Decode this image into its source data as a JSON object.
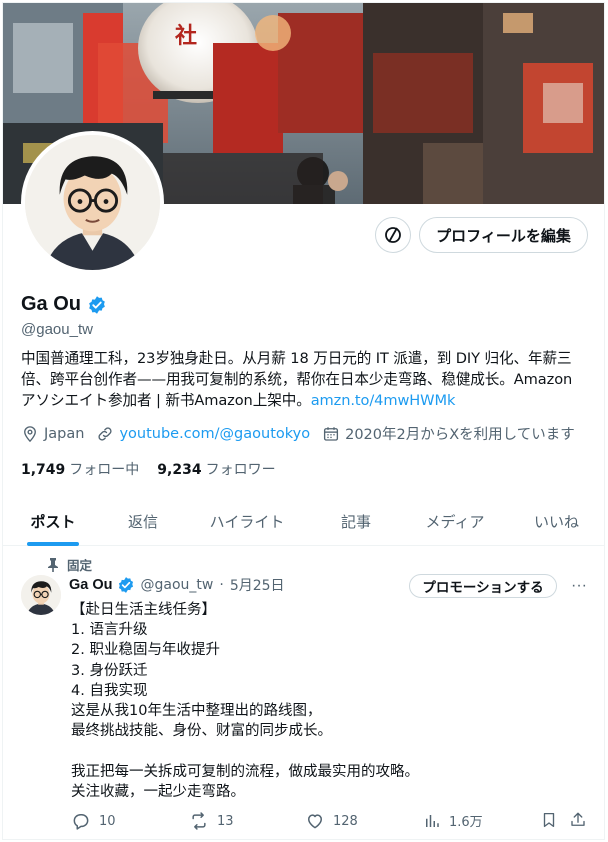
{
  "profile": {
    "name": "Ga Ou",
    "handle": "@gaou_tw",
    "bio_text": "中国普通理工科，23岁独身赴日。从月薪 18 万日元的 IT 派遣，到 DIY 归化、年薪三倍、跨平台创作者——用我可复制的系统，帮你在日本少走弯路、稳健成长。Amazon アソシエイト参加者 | 新书Amazon上架中。",
    "bio_link": "amzn.to/4mwHWMk",
    "location": "Japan",
    "website": "youtube.com/@gaoutokyo",
    "joined": "2020年2月からXを利用しています",
    "following_count": "1,749",
    "following_label": "フォロー中",
    "followers_count": "9,234",
    "followers_label": "フォロワー",
    "edit_button": "プロフィールを編集"
  },
  "tabs": [
    {
      "label": "ポスト"
    },
    {
      "label": "返信"
    },
    {
      "label": "ハイライト"
    },
    {
      "label": "記事"
    },
    {
      "label": "メディア"
    },
    {
      "label": "いいね"
    }
  ],
  "pinned_post": {
    "pinned_label": "固定",
    "author_name": "Ga Ou",
    "author_handle": "@gaou_tw",
    "separator": "·",
    "date": "5月25日",
    "promote_button": "プロモーションする",
    "more": "···",
    "body": "【赴日生活主线任务】\n1. 语言升级\n2. 职业稳固与年收提升\n3. 身份跃迁\n4. 自我实现\n这是从我10年生活中整理出的路线图，\n最终挑战技能、身份、财富的同步成长。\n\n我正把每一关拆成可复制的流程，做成最实用的攻略。\n关注收藏，一起少走弯路。",
    "replies": "10",
    "reposts": "13",
    "likes": "128",
    "views": "1.6万"
  },
  "colors": {
    "accent": "#1d9bf0",
    "text_primary": "#0f1419",
    "text_secondary": "#536471",
    "border": "#cfd9de"
  },
  "icons": {
    "verified": "verified-badge-icon",
    "location": "location-pin-icon",
    "link": "link-icon",
    "calendar": "calendar-icon",
    "pin": "pin-icon",
    "reply": "reply-icon",
    "repost": "repost-icon",
    "like": "heart-icon",
    "views": "views-chart-icon",
    "bookmark": "bookmark-icon",
    "share": "share-icon",
    "circle_slash": "circle-slash-icon"
  }
}
